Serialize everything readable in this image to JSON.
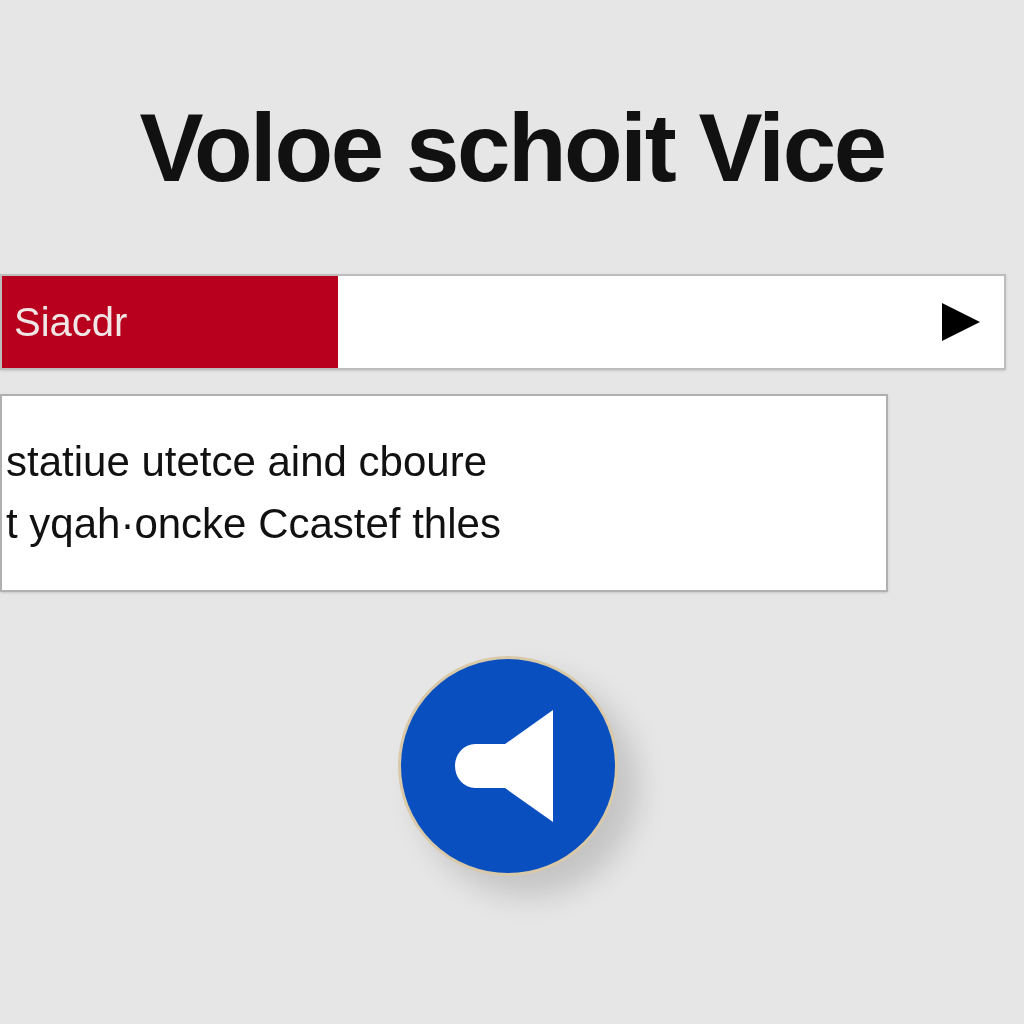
{
  "title": "Voloe schoit Vice",
  "search_bar": {
    "label": "Siacdr"
  },
  "message": {
    "lines": [
      "statiue utetce aind cboure",
      "t yqah·oncke Ccastef thles"
    ]
  }
}
